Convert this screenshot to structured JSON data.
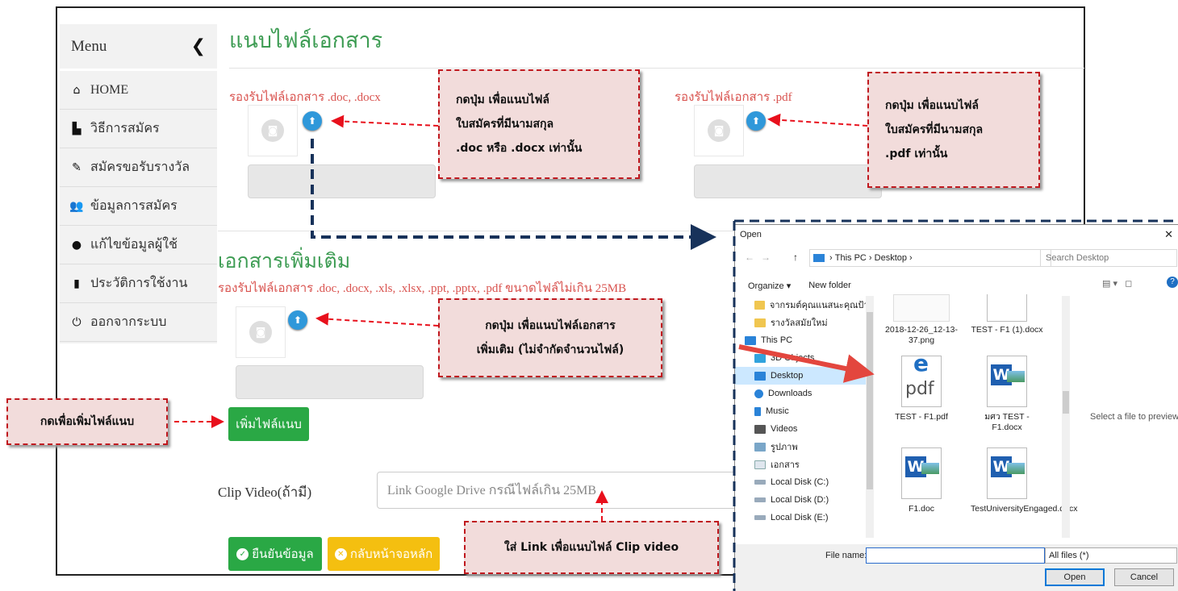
{
  "page": {
    "title": "แนบไฟล์เอกสาร",
    "section1": {
      "doc_hint": "รองรับไฟล์เอกสาร .doc, .docx",
      "pdf_hint": "รองรับไฟล์เอกสาร .pdf"
    },
    "section2": {
      "title": "เอกสารเพิ่มเติม",
      "hint": "รองรับไฟล์เอกสาร .doc, .docx, .xls, .xlsx, .ppt, .pptx, .pdf ขนาดไฟล์ไม่เกิน 25MB",
      "add_button": "เพิ่มไฟล์แนบ"
    },
    "clip": {
      "label": "Clip Video(ถ้ามี)",
      "placeholder": "Link Google Drive กรณีไฟล์เกิน 25MB"
    },
    "confirm_button": "ยืนยันข้อมูล",
    "back_button": "กลับหน้าจอหลัก"
  },
  "sidebar": {
    "title": "Menu",
    "items": [
      {
        "label": "HOME",
        "icon": "home-icon"
      },
      {
        "label": "วิธีการสมัคร",
        "icon": "file-icon"
      },
      {
        "label": "สมัครขอรับรางวัล",
        "icon": "pencil-icon"
      },
      {
        "label": "ข้อมูลการสมัคร",
        "icon": "users-icon"
      },
      {
        "label": "แก้ไขข้อมูลผู้ใช้",
        "icon": "user-icon"
      },
      {
        "label": "ประวัติการใช้งาน",
        "icon": "bookmark-icon"
      },
      {
        "label": "ออกจากระบบ",
        "icon": "power-icon"
      }
    ]
  },
  "callouts": {
    "doc": [
      "กดปุ่ม เพื่อแนบไฟล์",
      "ใบสมัครที่มีนามสกุล",
      ".doc หรือ .docx เท่านั้น"
    ],
    "pdf": [
      "กดปุ่ม เพื่อแนบไฟล์",
      "ใบสมัครที่มีนามสกุล",
      ".pdf เท่านั้น"
    ],
    "extra": [
      "กดปุ่ม เพื่อแนบไฟล์เอกสาร",
      "เพิ่มเติม  (ไม่จำกัดจำนวนไฟล์)"
    ],
    "add": "กดเพื่อเพิ่มไฟล์แนบ",
    "link": "ใส่ Link เพื่อแนบไฟล์ Clip video"
  },
  "dialog": {
    "title": "Open",
    "breadcrumb": [
      "This PC",
      "Desktop"
    ],
    "search_placeholder": "Search Desktop",
    "organize": "Organize ▾",
    "new_folder": "New folder",
    "nav_items": [
      {
        "label": "จากรมต์คุณแนสนะคุณป้าย",
        "kind": "folder"
      },
      {
        "label": "รางวัลสมัยใหม่",
        "kind": "folder"
      },
      {
        "label": "This PC",
        "kind": "pc"
      },
      {
        "label": "3D Objects",
        "kind": "3d"
      },
      {
        "label": "Desktop",
        "kind": "desktop",
        "selected": true
      },
      {
        "label": "Downloads",
        "kind": "downloads"
      },
      {
        "label": "Music",
        "kind": "music"
      },
      {
        "label": "Videos",
        "kind": "videos"
      },
      {
        "label": "รูปภาพ",
        "kind": "pictures"
      },
      {
        "label": "เอกสาร",
        "kind": "documents"
      },
      {
        "label": "Local Disk (C:)",
        "kind": "disk"
      },
      {
        "label": "Local Disk (D:)",
        "kind": "disk"
      },
      {
        "label": "Local Disk (E:)",
        "kind": "disk"
      }
    ],
    "files": [
      {
        "name": "2018-12-26_12-13-37.png",
        "type": "png"
      },
      {
        "name": "TEST - F1 (1).docx",
        "type": "docx"
      },
      {
        "name": "TEST - F1.pdf",
        "type": "pdf"
      },
      {
        "name": "มศว TEST - F1.docx",
        "type": "docx"
      },
      {
        "name": "F1.doc",
        "type": "doc"
      },
      {
        "name": "TestUniversityEngaged.docx",
        "type": "docx"
      }
    ],
    "preview_text": "Select a file to preview.",
    "file_name_label": "File name:",
    "file_type": "All files (*)",
    "open_button": "Open",
    "cancel_button": "Cancel"
  },
  "colors": {
    "green": "#3d9c53",
    "red_hint": "#d9534f",
    "callout_bg": "#f2dcdb",
    "callout_border": "#c0191f",
    "navy_arrow": "#17325a"
  }
}
